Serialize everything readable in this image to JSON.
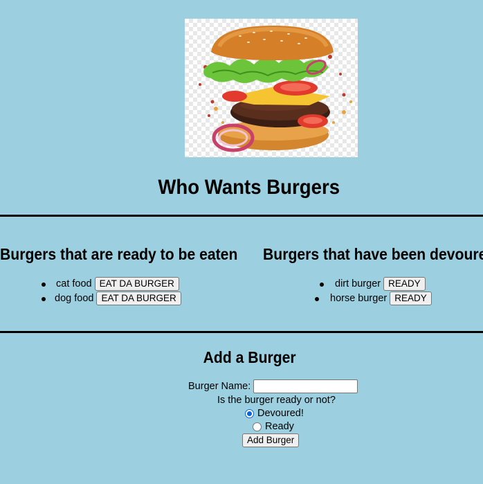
{
  "hero": {
    "image_name": "burger-photo"
  },
  "page_title": "Who Wants Burgers",
  "ready_section": {
    "title": "Burgers that are ready to be eaten",
    "items": [
      {
        "name": "cat food",
        "button": "EAT DA BURGER"
      },
      {
        "name": "dog food",
        "button": "EAT DA BURGER"
      }
    ]
  },
  "devoured_section": {
    "title": "Burgers that have been devoured",
    "items": [
      {
        "name": "dirt burger",
        "button": "READY"
      },
      {
        "name": "horse burger",
        "button": "READY"
      }
    ]
  },
  "form": {
    "title": "Add a Burger",
    "name_label": "Burger Name:",
    "name_value": "",
    "question": "Is the burger ready or not?",
    "options": [
      {
        "label": "Devoured!",
        "checked": true
      },
      {
        "label": "Ready",
        "checked": false
      }
    ],
    "submit_label": "Add Burger"
  },
  "colors": {
    "background": "#9ccfdf",
    "divider": "#000000",
    "radio_accent": "#0a66d8"
  }
}
